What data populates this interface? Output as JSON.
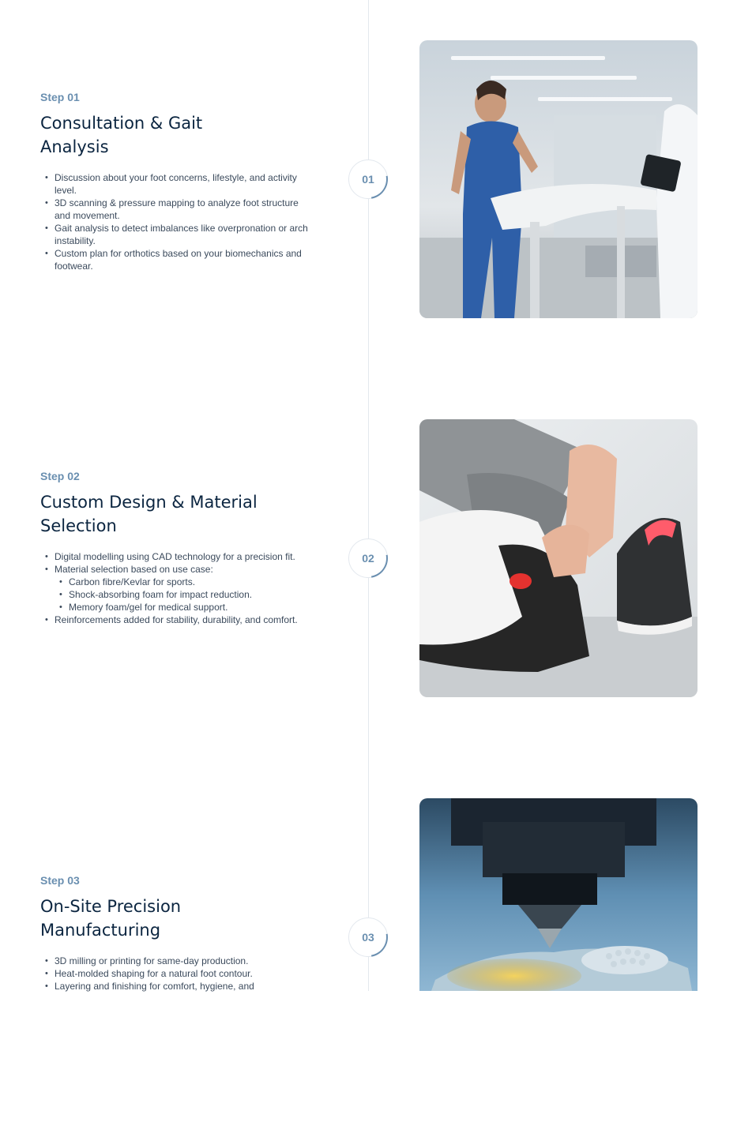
{
  "steps": [
    {
      "label": "Step 01",
      "title": "Consultation & Gait Analysis",
      "number": "01",
      "bullets": [
        "Discussion about your foot concerns, lifestyle, and activity level.",
        "3D scanning & pressure mapping to analyze foot structure and movement.",
        "Gait analysis to detect imbalances like overpronation or arch instability.",
        "Custom plan for orthotics based on your biomechanics and footwear."
      ],
      "image": "treadmill-gait-analysis-photo"
    },
    {
      "label": "Step 02",
      "title": "Custom Design & Material Selection",
      "number": "02",
      "bullets": [
        "Digital modelling using CAD technology for a precision fit.",
        "Material selection based on use case:",
        "Carbon fibre/Kevlar for sports.",
        "Shock-absorbing foam for impact reduction.",
        "Memory foam/gel for medical support.",
        "Reinforcements added for stability, durability, and comfort."
      ],
      "image": "orthotic-insole-fitting-photo"
    },
    {
      "label": "Step 03",
      "title": "On-Site Precision Manufacturing",
      "number": "03",
      "bullets": [
        "3D milling or printing for same-day production.",
        "Heat-molded shaping for a natural foot contour.",
        "Layering and finishing for comfort, hygiene, and"
      ],
      "image": "3d-printing-insole-photo"
    }
  ],
  "colors": {
    "accent": "#6a8fb0",
    "heading": "#0b2540",
    "body_text": "#3b4a5c",
    "line": "#e3e8ee"
  }
}
